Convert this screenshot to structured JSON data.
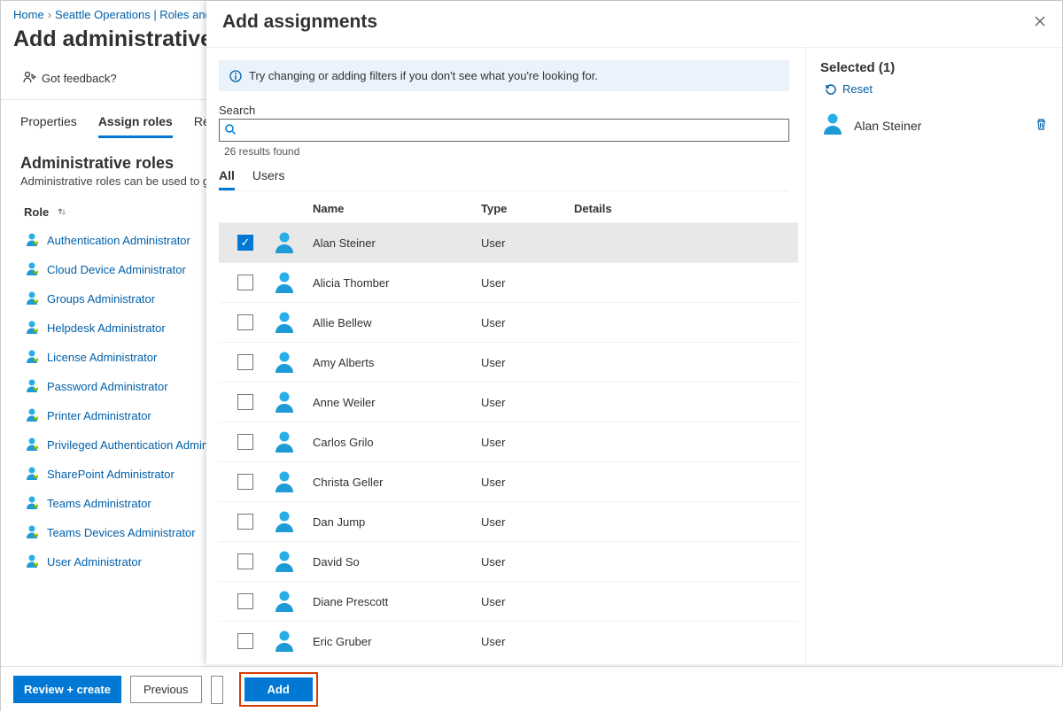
{
  "breadcrumbs": {
    "home": "Home",
    "seattle": "Seattle Operations | Roles and"
  },
  "page_title": "Add administrative uni",
  "feedback": "Got feedback?",
  "bg_tabs": {
    "properties": "Properties",
    "assign_roles": "Assign roles",
    "review": "Review"
  },
  "roles_section": {
    "heading": "Administrative roles",
    "sub": "Administrative roles can be used to grant",
    "col": "Role",
    "items": [
      "Authentication Administrator",
      "Cloud Device Administrator",
      "Groups Administrator",
      "Helpdesk Administrator",
      "License Administrator",
      "Password Administrator",
      "Printer Administrator",
      "Privileged Authentication Administ",
      "SharePoint Administrator",
      "Teams Administrator",
      "Teams Devices Administrator",
      "User Administrator"
    ]
  },
  "footer": {
    "review_create": "Review + create",
    "previous": "Previous",
    "add": "Add"
  },
  "panel": {
    "title": "Add assignments",
    "info": "Try changing or adding filters if you don't see what you're looking for.",
    "search_label": "Search",
    "search_placeholder": "",
    "results_found": "26 results found",
    "tabs": {
      "all": "All",
      "users": "Users"
    },
    "columns": {
      "name": "Name",
      "type": "Type",
      "details": "Details"
    },
    "users": [
      {
        "name": "Alan Steiner",
        "type": "User",
        "selected": true
      },
      {
        "name": "Alicia Thomber",
        "type": "User",
        "selected": false
      },
      {
        "name": "Allie Bellew",
        "type": "User",
        "selected": false
      },
      {
        "name": "Amy Alberts",
        "type": "User",
        "selected": false
      },
      {
        "name": "Anne Weiler",
        "type": "User",
        "selected": false
      },
      {
        "name": "Carlos Grilo",
        "type": "User",
        "selected": false
      },
      {
        "name": "Christa Geller",
        "type": "User",
        "selected": false
      },
      {
        "name": "Dan Jump",
        "type": "User",
        "selected": false
      },
      {
        "name": "David So",
        "type": "User",
        "selected": false
      },
      {
        "name": "Diane Prescott",
        "type": "User",
        "selected": false
      },
      {
        "name": "Eric Gruber",
        "type": "User",
        "selected": false
      }
    ],
    "selected_heading": "Selected (1)",
    "reset": "Reset",
    "selected_items": [
      {
        "name": "Alan Steiner"
      }
    ]
  }
}
